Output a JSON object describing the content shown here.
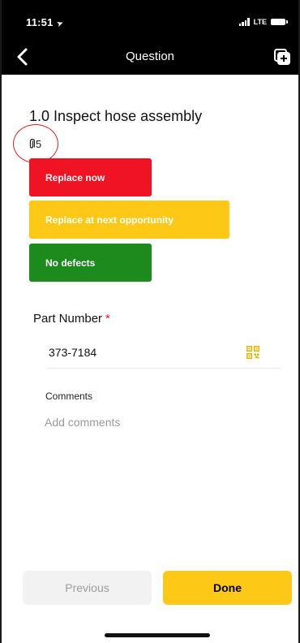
{
  "status_bar": {
    "time": "11:51",
    "network": "LTE"
  },
  "nav": {
    "title": "Question"
  },
  "question": {
    "title": "1.0 Inspect hose assembly",
    "attachment_count": "5"
  },
  "options": [
    {
      "label": "Replace now",
      "color": "#f01323"
    },
    {
      "label": "Replace at next opportunity",
      "color": "#fdc816"
    },
    {
      "label": "No defects",
      "color": "#1c8a1c"
    }
  ],
  "part_number": {
    "label": "Part Number",
    "required_marker": "*",
    "value": "373-7184"
  },
  "comments": {
    "label": "Comments",
    "placeholder": "Add comments"
  },
  "footer": {
    "previous_label": "Previous",
    "done_label": "Done"
  },
  "colors": {
    "accent": "#fdc816",
    "header_bg": "#000000",
    "required": "#e01a1a"
  }
}
